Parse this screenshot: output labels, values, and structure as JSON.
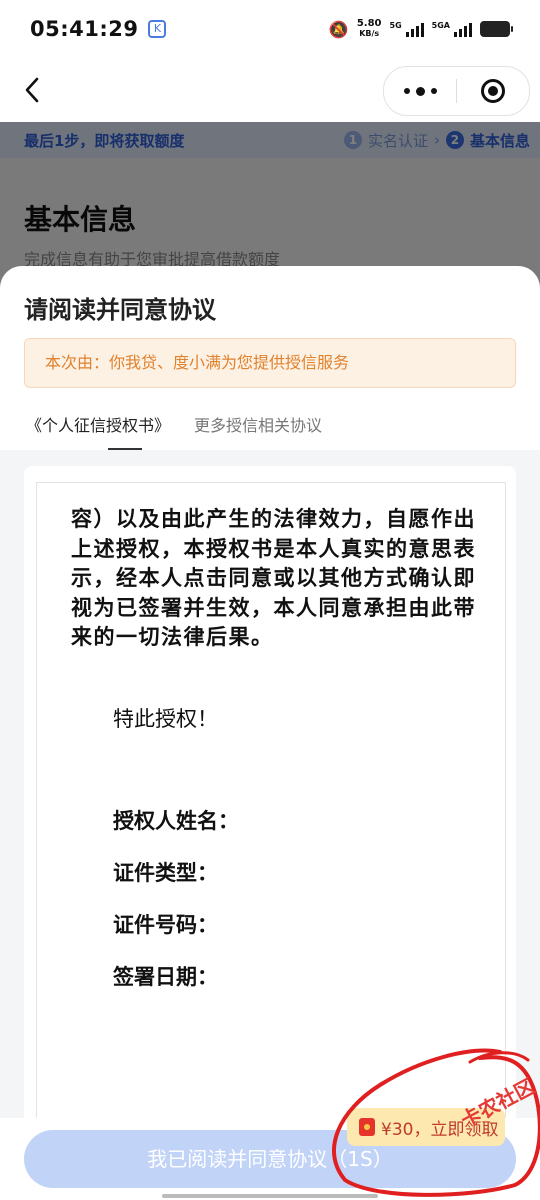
{
  "status_bar": {
    "time": "05:41:29",
    "net_speed_value": "5.80",
    "net_speed_unit": "KB/s",
    "sim1_label": "5G",
    "sim2_label": "5GA"
  },
  "background_page": {
    "step_hint": "最后1步，即将获取额度",
    "steps": [
      {
        "num": "1",
        "label": "实名认证"
      },
      {
        "num": "2",
        "label": "基本信息"
      }
    ],
    "title": "基本信息",
    "subtitle": "完成信息有助于您审批提高借款额度"
  },
  "sheet": {
    "title": "请阅读并同意协议",
    "notice": "本次由：你我贷、度小满为您提供授信服务",
    "tabs": [
      {
        "label": "《个人征信授权书》"
      },
      {
        "label": "更多授信相关协议"
      }
    ]
  },
  "document": {
    "paragraph": "容）以及由此产生的法律效力，自愿作出上述授权，本授权书是本人真实的意思表示，经本人点击同意或以其他方式确认即视为已签署并生效，本人同意承担由此带来的一切法律后果。",
    "closing": "特此授权！",
    "fields": [
      "授权人姓名：",
      "证件类型：",
      "证件号码：",
      "签署日期："
    ]
  },
  "bottom": {
    "agree_button": "我已阅读并同意协议（1S）",
    "reward_text": "¥30，立即领取"
  },
  "watermark": "卡农社区",
  "colors": {
    "accent": "#3a6ae0",
    "notice_text": "#e0822e",
    "button_disabled": "#c2d3f8",
    "scribble": "#e02020"
  },
  "icons": [
    "back-arrow-icon",
    "more-dots-icon",
    "close-target-icon",
    "red-packet-icon",
    "bell-off-icon",
    "battery-icon"
  ]
}
